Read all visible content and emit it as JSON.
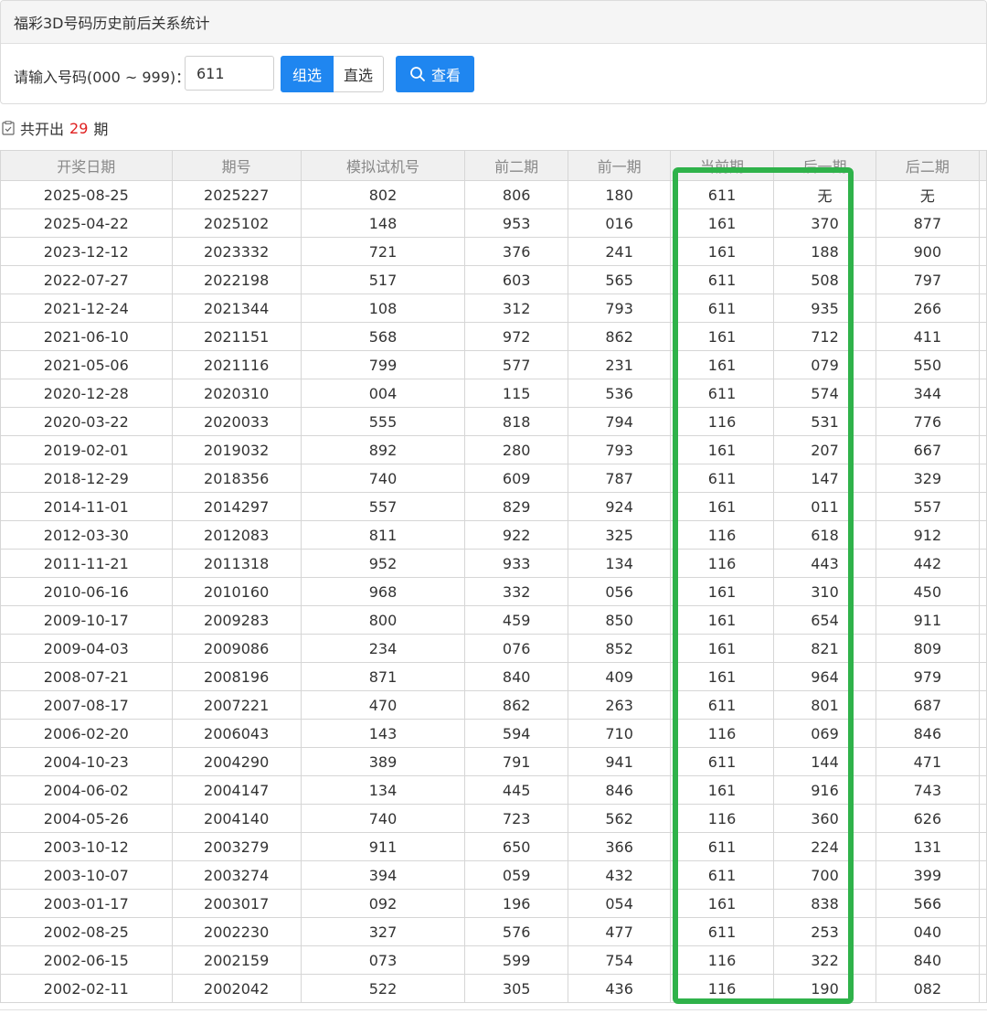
{
  "title": "福彩3D号码历史前后关系统计",
  "query": {
    "label": "请输入号码(000 ~ 999)：",
    "value": "611",
    "group_btn": "组选",
    "direct_btn": "直选",
    "view_btn": "查看",
    "view_icon": "search-icon"
  },
  "summary": {
    "prefix": "共开出",
    "count": "29",
    "suffix": "期"
  },
  "table": {
    "headers": [
      "开奖日期",
      "期号",
      "模拟试机号",
      "前二期",
      "前一期",
      "当前期",
      "后一期",
      "后二期"
    ],
    "rows": [
      [
        "2025-08-25",
        "2025227",
        "802",
        "806",
        "180",
        "611",
        "无",
        "无"
      ],
      [
        "2025-04-22",
        "2025102",
        "148",
        "953",
        "016",
        "161",
        "370",
        "877"
      ],
      [
        "2023-12-12",
        "2023332",
        "721",
        "376",
        "241",
        "161",
        "188",
        "900"
      ],
      [
        "2022-07-27",
        "2022198",
        "517",
        "603",
        "565",
        "611",
        "508",
        "797"
      ],
      [
        "2021-12-24",
        "2021344",
        "108",
        "312",
        "793",
        "611",
        "935",
        "266"
      ],
      [
        "2021-06-10",
        "2021151",
        "568",
        "972",
        "862",
        "161",
        "712",
        "411"
      ],
      [
        "2021-05-06",
        "2021116",
        "799",
        "577",
        "231",
        "161",
        "079",
        "550"
      ],
      [
        "2020-12-28",
        "2020310",
        "004",
        "115",
        "536",
        "611",
        "574",
        "344"
      ],
      [
        "2020-03-22",
        "2020033",
        "555",
        "818",
        "794",
        "116",
        "531",
        "776"
      ],
      [
        "2019-02-01",
        "2019032",
        "892",
        "280",
        "793",
        "161",
        "207",
        "667"
      ],
      [
        "2018-12-29",
        "2018356",
        "740",
        "609",
        "787",
        "611",
        "147",
        "329"
      ],
      [
        "2014-11-01",
        "2014297",
        "557",
        "829",
        "924",
        "161",
        "011",
        "557"
      ],
      [
        "2012-03-30",
        "2012083",
        "811",
        "922",
        "325",
        "116",
        "618",
        "912"
      ],
      [
        "2011-11-21",
        "2011318",
        "952",
        "933",
        "134",
        "116",
        "443",
        "442"
      ],
      [
        "2010-06-16",
        "2010160",
        "968",
        "332",
        "056",
        "161",
        "310",
        "450"
      ],
      [
        "2009-10-17",
        "2009283",
        "800",
        "459",
        "850",
        "161",
        "654",
        "911"
      ],
      [
        "2009-04-03",
        "2009086",
        "234",
        "076",
        "852",
        "161",
        "821",
        "809"
      ],
      [
        "2008-07-21",
        "2008196",
        "871",
        "840",
        "409",
        "161",
        "964",
        "979"
      ],
      [
        "2007-08-17",
        "2007221",
        "470",
        "862",
        "263",
        "611",
        "801",
        "687"
      ],
      [
        "2006-02-20",
        "2006043",
        "143",
        "594",
        "710",
        "116",
        "069",
        "846"
      ],
      [
        "2004-10-23",
        "2004290",
        "389",
        "791",
        "941",
        "611",
        "144",
        "471"
      ],
      [
        "2004-06-02",
        "2004147",
        "134",
        "445",
        "846",
        "161",
        "916",
        "743"
      ],
      [
        "2004-05-26",
        "2004140",
        "740",
        "723",
        "562",
        "116",
        "360",
        "626"
      ],
      [
        "2003-10-12",
        "2003279",
        "911",
        "650",
        "366",
        "611",
        "224",
        "131"
      ],
      [
        "2003-10-07",
        "2003274",
        "394",
        "059",
        "432",
        "611",
        "700",
        "399"
      ],
      [
        "2003-01-17",
        "2003017",
        "092",
        "196",
        "054",
        "161",
        "838",
        "566"
      ],
      [
        "2002-08-25",
        "2002230",
        "327",
        "576",
        "477",
        "611",
        "253",
        "040"
      ],
      [
        "2002-06-15",
        "2002159",
        "073",
        "599",
        "754",
        "116",
        "322",
        "840"
      ],
      [
        "2002-02-11",
        "2002042",
        "522",
        "305",
        "436",
        "116",
        "190",
        "082"
      ]
    ]
  },
  "colors": {
    "primary": "#1f86f0",
    "highlight": "#2fb24a",
    "count": "#e02020"
  }
}
